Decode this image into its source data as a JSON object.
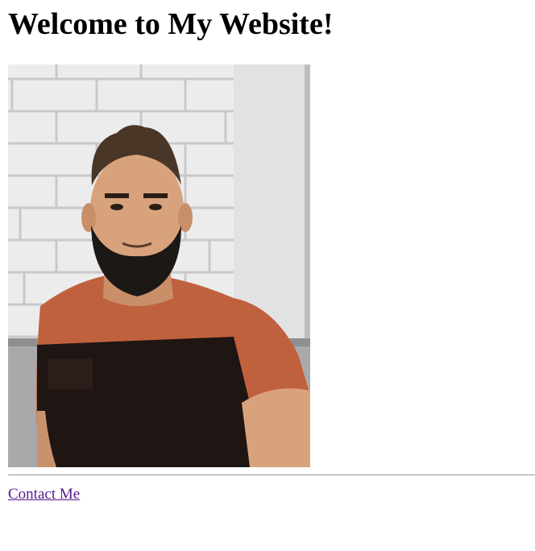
{
  "page": {
    "title": "Welcome to My Website!"
  },
  "photo": {
    "description_icon": "portrait-photo",
    "colors": {
      "wall": "#ececed",
      "brick_mortar": "#cfcfd1",
      "shirt_orange": "#c0613d",
      "shirt_dark": "#1f1513",
      "skin": "#d8a37c",
      "hair": "#4a3627",
      "beard": "#1c1815"
    }
  },
  "footer": {
    "contact_label": "Contact Me",
    "link_color": "#551a8b"
  }
}
